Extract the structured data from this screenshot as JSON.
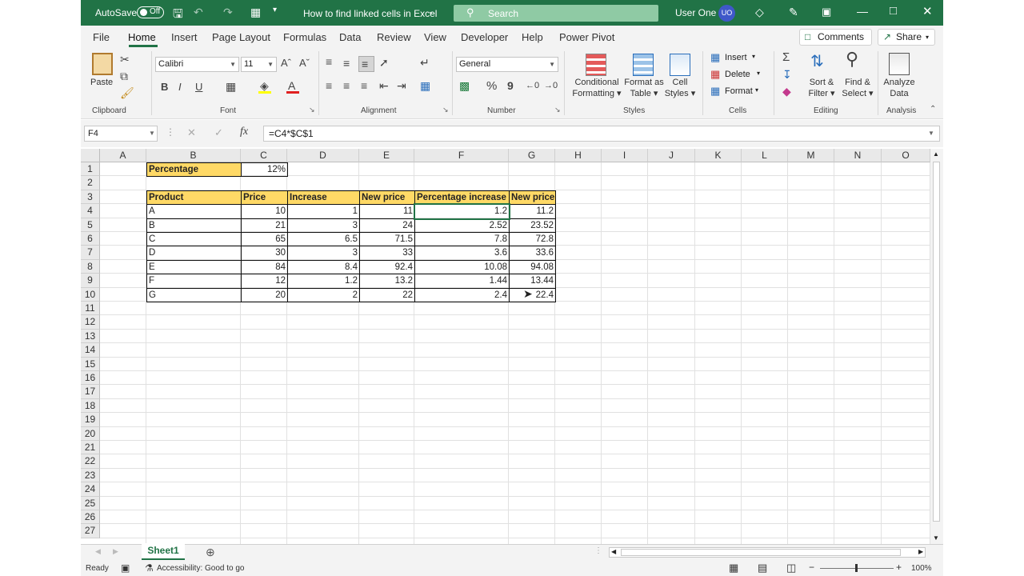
{
  "titlebar": {
    "autosave_label": "AutoSave",
    "autosave_state": "Off",
    "doc_title": "How to find linked cells in Excel",
    "search_placeholder": "Search",
    "user_name": "User One",
    "user_initials": "UO"
  },
  "menu": {
    "items": [
      "File",
      "Home",
      "Insert",
      "Page Layout",
      "Formulas",
      "Data",
      "Review",
      "View",
      "Developer",
      "Help",
      "Power Pivot"
    ],
    "active": "Home",
    "comments_label": "Comments",
    "share_label": "Share"
  },
  "ribbon": {
    "clipboard": {
      "paste_label": "Paste",
      "group_label": "Clipboard"
    },
    "font": {
      "font_name": "Calibri",
      "font_size": "11",
      "group_label": "Font",
      "bold": "B",
      "italic": "I",
      "underline": "U"
    },
    "alignment": {
      "group_label": "Alignment"
    },
    "number": {
      "format": "General",
      "group_label": "Number",
      "percent": "%",
      "comma": "9"
    },
    "styles": {
      "conditional_line1": "Conditional",
      "conditional_line2": "Formatting",
      "format_table_line1": "Format as",
      "format_table_line2": "Table",
      "cell_styles_line1": "Cell",
      "cell_styles_line2": "Styles",
      "group_label": "Styles"
    },
    "cells": {
      "insert": "Insert",
      "delete": "Delete",
      "format": "Format",
      "group_label": "Cells"
    },
    "editing": {
      "sort_line1": "Sort &",
      "sort_line2": "Filter",
      "find_line1": "Find &",
      "find_line2": "Select",
      "group_label": "Editing"
    },
    "analysis": {
      "analyze_line1": "Analyze",
      "analyze_line2": "Data",
      "group_label": "Analysis"
    }
  },
  "formula_bar": {
    "name_box": "F4",
    "fx": "fx",
    "formula": "=C4*$C$1"
  },
  "grid": {
    "columns": [
      "A",
      "B",
      "C",
      "D",
      "E",
      "F",
      "G",
      "H",
      "I",
      "J",
      "K",
      "L",
      "M",
      "N",
      "O"
    ],
    "rows": [
      "1",
      "2",
      "3",
      "4",
      "5",
      "6",
      "7",
      "8",
      "9",
      "10",
      "11",
      "12",
      "13",
      "14",
      "15",
      "16",
      "17",
      "18",
      "19",
      "20",
      "21",
      "22",
      "23",
      "24",
      "25",
      "26",
      "27"
    ],
    "percentage_label": "Percentage",
    "percentage_value": "12%",
    "table_headers": [
      "Product",
      "Price",
      "Increase",
      "New price",
      "Percentage increase",
      "New price"
    ],
    "table_rows": [
      [
        "A",
        "10",
        "1",
        "11",
        "1.2",
        "11.2"
      ],
      [
        "B",
        "21",
        "3",
        "24",
        "2.52",
        "23.52"
      ],
      [
        "C",
        "65",
        "6.5",
        "71.5",
        "7.8",
        "72.8"
      ],
      [
        "D",
        "30",
        "3",
        "33",
        "3.6",
        "33.6"
      ],
      [
        "E",
        "84",
        "8.4",
        "92.4",
        "10.08",
        "94.08"
      ],
      [
        "F",
        "12",
        "1.2",
        "13.2",
        "1.44",
        "13.44"
      ],
      [
        "G",
        "20",
        "2",
        "22",
        "2.4",
        "22.4"
      ]
    ]
  },
  "sheets": {
    "active": "Sheet1"
  },
  "status": {
    "ready": "Ready",
    "accessibility": "Accessibility: Good to go",
    "zoom": "100%"
  },
  "colors": {
    "accent": "#217346",
    "header_fill": "#ffd966"
  }
}
